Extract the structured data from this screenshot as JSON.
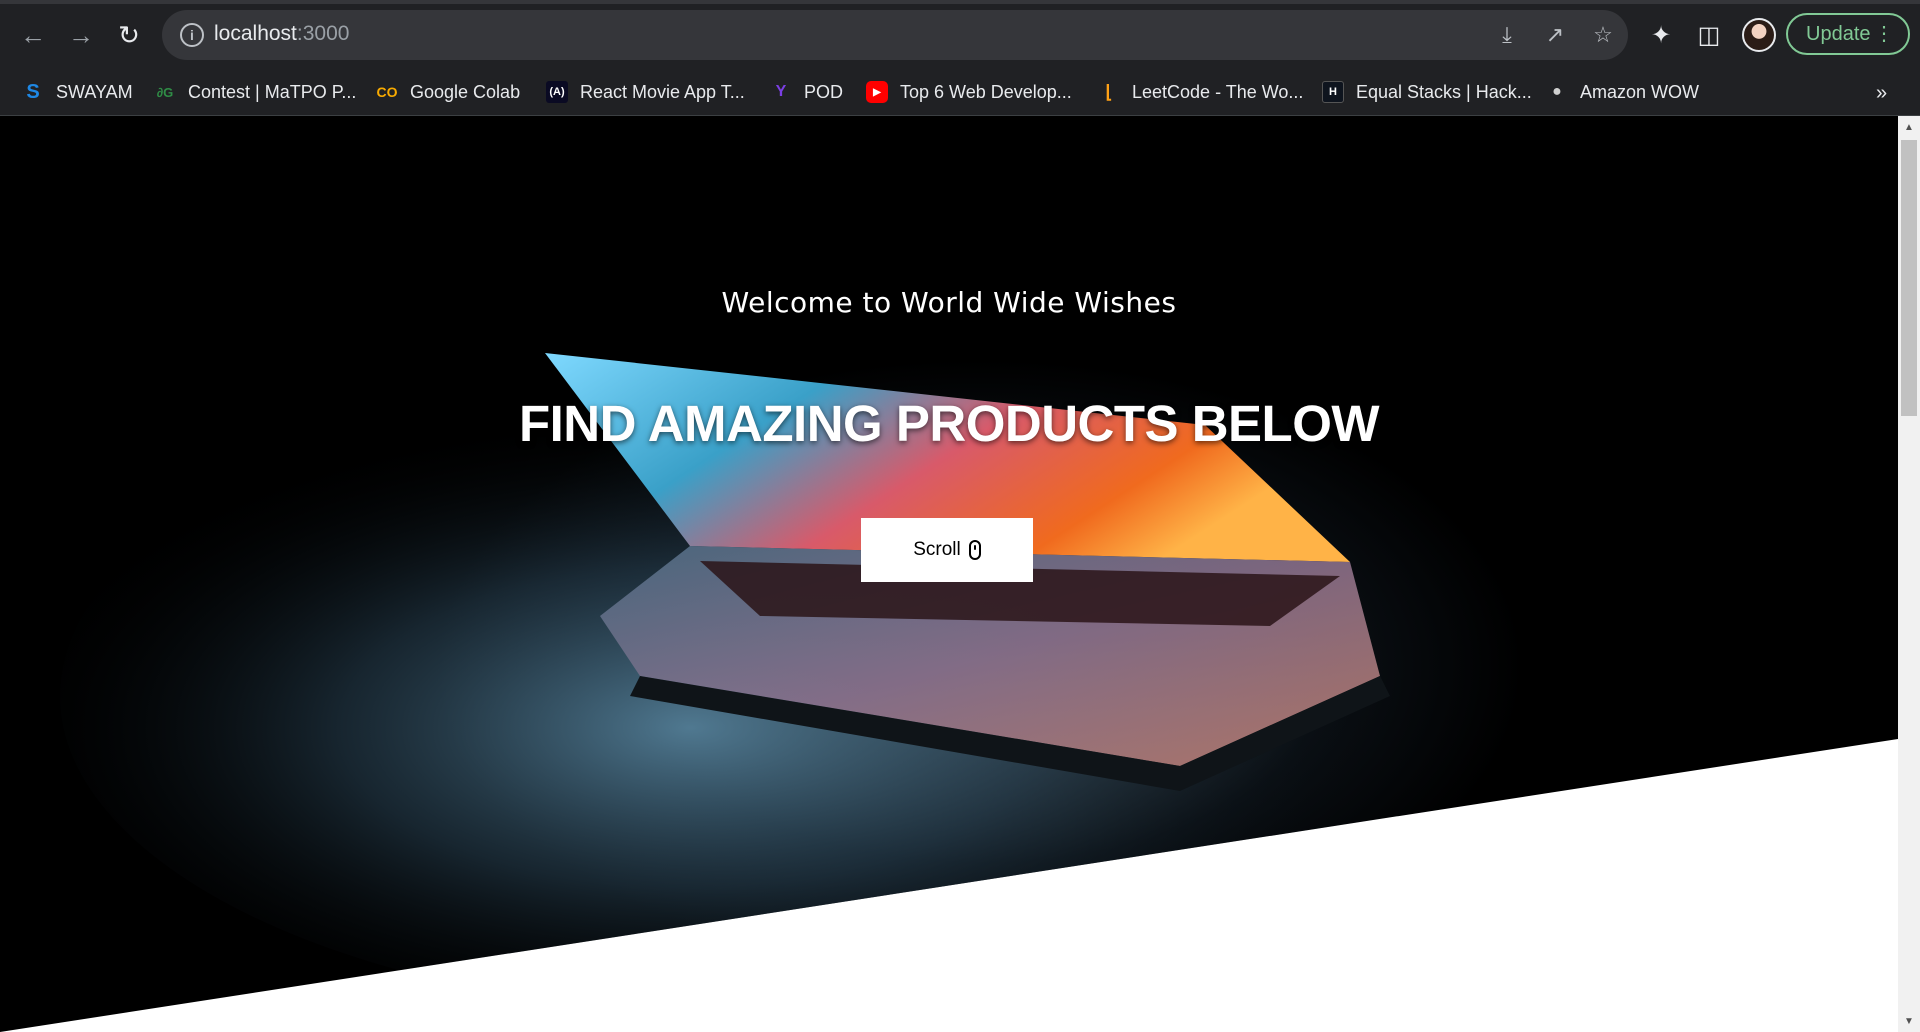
{
  "browser": {
    "url_host": "localhost",
    "url_port": ":3000",
    "update_label": "Update"
  },
  "bookmarks": [
    {
      "label": "SWAYAM",
      "icon": "swayam-icon",
      "color": "#1e88e5",
      "glyph": "S"
    },
    {
      "label": "Contest | MaTPO P...",
      "icon": "geeksforgeeks-icon",
      "color": "#2f8d46",
      "glyph": "∂G"
    },
    {
      "label": "Google Colab",
      "icon": "colab-icon",
      "color": "#f9ab00",
      "glyph": "CO"
    },
    {
      "label": "React Movie App T...",
      "icon": "freecodecamp-icon",
      "color": "#0a0a23",
      "glyph": "(ʎ)"
    },
    {
      "label": "POD",
      "icon": "pod-icon",
      "color": "#7b3fe4",
      "glyph": "Y"
    },
    {
      "label": "Top 6 Web Develop...",
      "icon": "youtube-icon",
      "color": "#ff0000",
      "glyph": "▶"
    },
    {
      "label": "LeetCode - The Wo...",
      "icon": "leetcode-icon",
      "color": "#ffa116",
      "glyph": "⌊"
    },
    {
      "label": "Equal Stacks | Hack...",
      "icon": "hackerrank-icon",
      "color": "#0e141e",
      "glyph": "H"
    },
    {
      "label": "Amazon WOW",
      "icon": "amazon-wow-icon",
      "color": "#111111",
      "glyph": "●"
    }
  ],
  "hero": {
    "welcome": "Welcome to World Wide Wishes",
    "headline": "FIND AMAZING PRODUCTS BELOW",
    "scroll_label": "Scroll"
  }
}
